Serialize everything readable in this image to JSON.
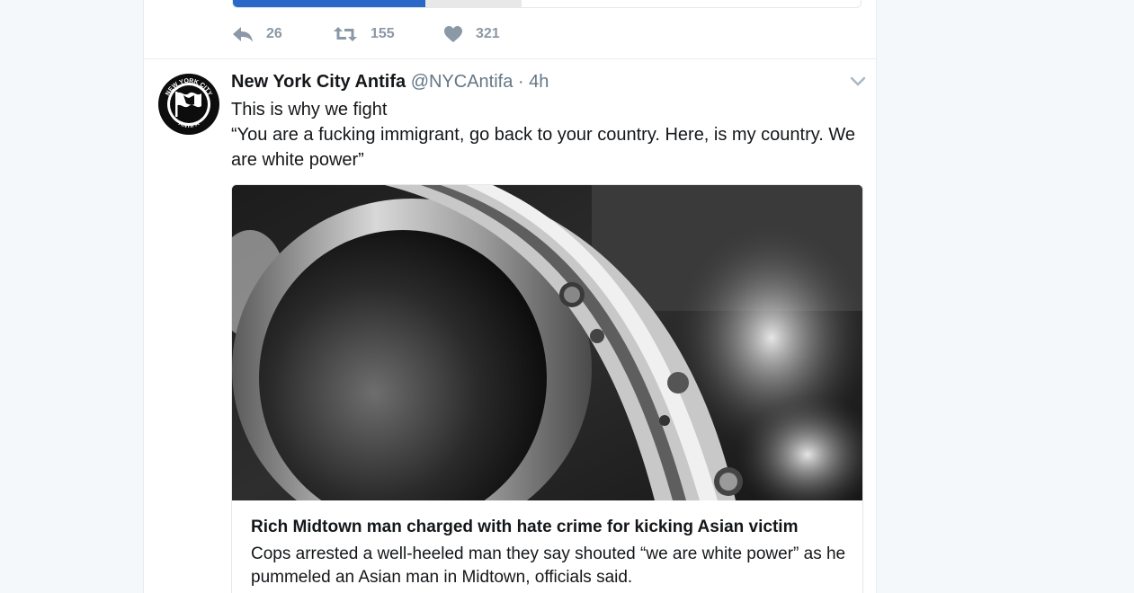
{
  "previous_tweet": {
    "reply_count": "26",
    "retweet_count": "155",
    "like_count": "321"
  },
  "tweet": {
    "display_name": "New York City Antifa",
    "handle": "@NYCAntifa",
    "separator": "·",
    "time": "4h",
    "text_line1": "This is why we fight",
    "text_line2": "“You are a fucking immigrant, go back to your country. Here, is my country. We are white power”",
    "avatar_text_top": "NEW YORK CITY",
    "avatar_text_bottom": "ANTIFA",
    "card": {
      "title": "Rich Midtown man charged with hate crime for kicking Asian victim",
      "description": "Cops arrested a well-heeled man they say shouted “we are white power” as he pummeled an Asian man in Midtown, officials said."
    }
  },
  "colors": {
    "accent_blue": "#2a68c8",
    "muted_text": "#8b98a5",
    "border": "#e1e8ed"
  }
}
